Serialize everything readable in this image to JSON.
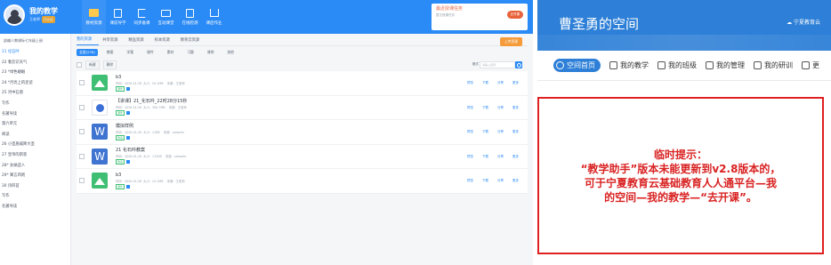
{
  "left_app": {
    "brand": {
      "title": "我的教学",
      "subtitle": "王老师",
      "badge": "已认证"
    },
    "nav": [
      {
        "label": "教材资源",
        "icon": "folder-icon"
      },
      {
        "label": "课前导学",
        "icon": "document-icon"
      },
      {
        "label": "同步备课",
        "icon": "edit-icon"
      },
      {
        "label": "互动课堂",
        "icon": "screen-icon"
      },
      {
        "label": "在线检测",
        "icon": "check-icon"
      },
      {
        "label": "课后作业",
        "icon": "home-icon"
      }
    ],
    "task": {
      "title": "最近授课任务",
      "subtitle": "暂无授课任务",
      "button": "去开课"
    },
    "sidebar": {
      "header": "部编人教课标七年级上册",
      "items": [
        "21 化石吟",
        "22 看云识天气",
        "23 *绿色蝈蝈",
        "24 *月亮上的足迹",
        "25 河中石兽",
        "写作",
        "名著导读",
        "第六单元",
        "阅读",
        "26 小圣施威降大圣",
        "27 皇帝的新装",
        "28* 女娲造人",
        "29* 寓言四则",
        "30 诗四首",
        "写作",
        "名著导读"
      ]
    },
    "tabs": [
      "我的资源",
      "共享资源",
      "精品资源",
      "校本资源",
      "教育云资源"
    ],
    "upload_label": "上传资源",
    "filters": [
      "全部(278)",
      "教案",
      "学案",
      "课件",
      "素材",
      "习题",
      "课例",
      "其他"
    ],
    "toolbar": {
      "add_label": "新建",
      "delete_label": "删除",
      "sort_label": "格式",
      "search_placeholder": "请输入名称"
    },
    "rows": [
      {
        "title": "b3",
        "date": "时间：2020-01-28",
        "size": "大小：24.1MB",
        "source": "来源：王老师",
        "tag": "课件",
        "type": "image"
      },
      {
        "title": "【讲课】21_化石吟_22时28分15秒",
        "date": "时间：2020-01-28",
        "size": "大小：300.7MB",
        "source": "来源：王老师",
        "tag": "课件",
        "type": "video"
      },
      {
        "title": "模拟样例",
        "date": "时间：2020-01-28",
        "size": "大小：11KB",
        "source": "来源：zxbwzfx",
        "tag": "教案",
        "type": "word"
      },
      {
        "title": "21 化石吟教案",
        "date": "时间：2020-01-28",
        "size": "大小：112KB",
        "source": "来源：zxbwzfx",
        "tag": "教案",
        "type": "word"
      },
      {
        "title": "b3",
        "date": "时间：2020-01-28",
        "size": "大小：24.1MB",
        "source": "来源：王老师",
        "tag": "课件",
        "type": "image"
      }
    ],
    "row_actions": [
      "预览",
      "下载",
      "分享",
      "更多"
    ]
  },
  "right_app": {
    "title": "曹圣勇的空间",
    "brand": "宁夏教育云",
    "nav": [
      {
        "label": "空间首页",
        "active": true
      },
      {
        "label": "我的教学",
        "active": false
      },
      {
        "label": "我的班级",
        "active": false
      },
      {
        "label": "我的管理",
        "active": false
      },
      {
        "label": "我的研训",
        "active": false
      },
      {
        "label": "更",
        "active": false
      }
    ],
    "notice": [
      "临时提示：",
      "“教学助手”版本未能更新到v2.8版本的，",
      "可于宁夏教育云基础教育人人通平台—我",
      "的空间—我的教学—“去开课”。"
    ]
  }
}
